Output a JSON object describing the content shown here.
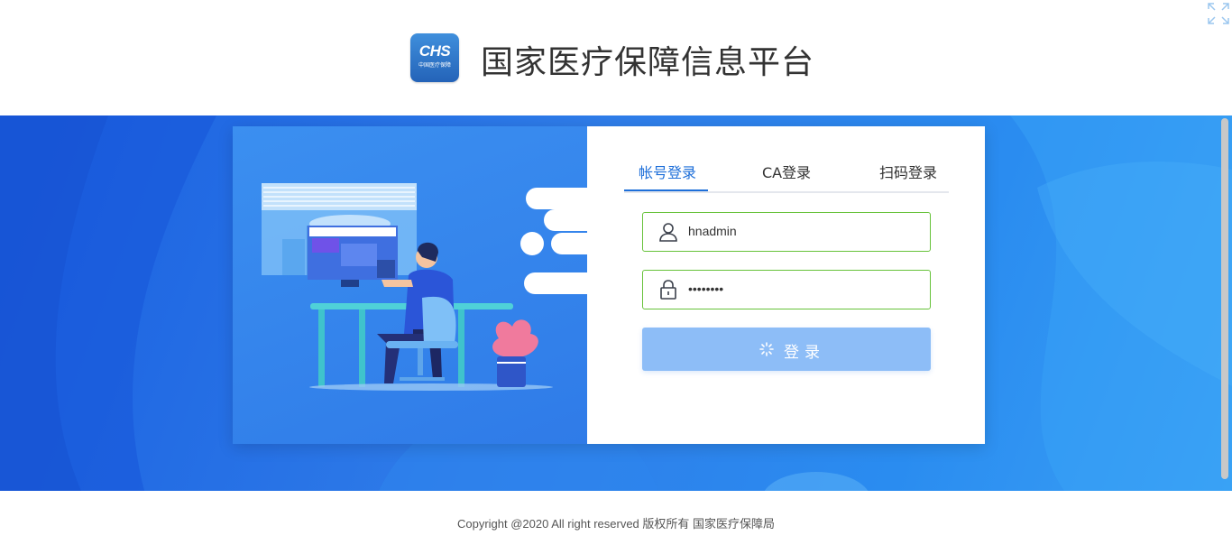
{
  "header": {
    "logo_text": "CHS",
    "logo_subtext": "中国医疗保障",
    "title": "国家医疗保障信息平台"
  },
  "login": {
    "tabs": [
      {
        "label": "帐号登录",
        "active": true
      },
      {
        "label": "CA登录",
        "active": false
      },
      {
        "label": "扫码登录",
        "active": false
      }
    ],
    "username": "hnadmin",
    "password": "••••••••",
    "submit_label": "登录"
  },
  "footer": {
    "copyright": "Copyright @2020 All right reserved 版权所有 国家医疗保障局"
  },
  "colors": {
    "brand_blue": "#1e6fd9",
    "banner_blue": "#2a7de8",
    "input_border_success": "#67c23a",
    "button_loading": "#8dbdf7"
  },
  "icons": [
    "fullscreen-icon",
    "user-icon",
    "lock-icon",
    "loading-icon"
  ]
}
